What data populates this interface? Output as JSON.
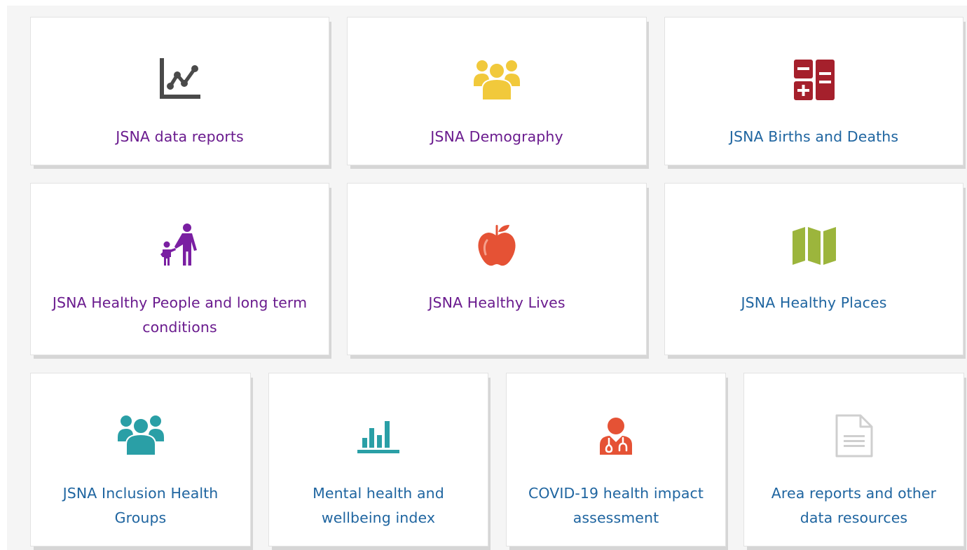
{
  "colors": {
    "purple_text": "#6a1b8e",
    "blue_text": "#1f65a0",
    "icon_grey": "#4a4a4a",
    "icon_yellow": "#f1c93b",
    "icon_red": "#a5202c",
    "icon_purple": "#7a1fa2",
    "icon_tomato": "#e55235",
    "icon_green": "#9cb53c",
    "icon_teal": "#2a9fa6",
    "icon_lightgrey": "#cfcfcf"
  },
  "tiles": [
    {
      "label": "JSNA data reports",
      "icon": "line-chart-icon"
    },
    {
      "label": "JSNA Demography",
      "icon": "people-group-icon"
    },
    {
      "label": "JSNA Births and Deaths",
      "icon": "calculator-icon"
    },
    {
      "label": "JSNA Healthy People and long term conditions",
      "icon": "parent-child-icon"
    },
    {
      "label": "JSNA Healthy Lives",
      "icon": "apple-icon"
    },
    {
      "label": "JSNA Healthy Places",
      "icon": "map-icon"
    },
    {
      "label": "JSNA Inclusion Health Groups",
      "icon": "people-group-icon"
    },
    {
      "label": "Mental health and wellbeing index",
      "icon": "bar-chart-icon"
    },
    {
      "label": "COVID-19 health impact assessment",
      "icon": "doctor-icon"
    },
    {
      "label": "Area reports and other data resources",
      "icon": "document-icon"
    }
  ]
}
